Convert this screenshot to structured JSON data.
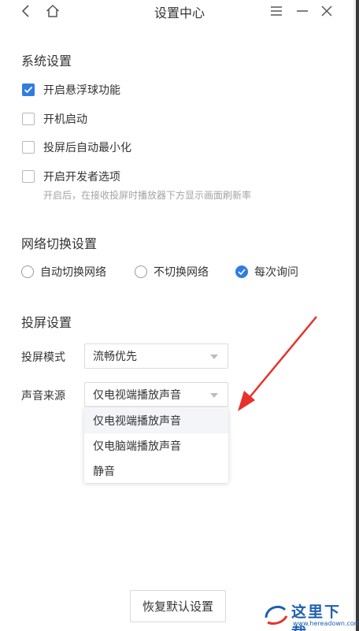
{
  "window": {
    "title": "设置中心"
  },
  "system_settings": {
    "heading": "系统设置",
    "options": [
      {
        "label": "开启悬浮球功能",
        "checked": true
      },
      {
        "label": "开机启动",
        "checked": false
      },
      {
        "label": "投屏后自动最小化",
        "checked": false
      },
      {
        "label": "开启开发者选项",
        "checked": false
      }
    ],
    "developer_hint": "开启后，在接收投屏时播放器下方显示画面刷新率"
  },
  "network_settings": {
    "heading": "网络切换设置",
    "options": [
      {
        "label": "自动切换网络",
        "selected": false
      },
      {
        "label": "不切换网络",
        "selected": false
      },
      {
        "label": "每次询问",
        "selected": true
      }
    ]
  },
  "cast_settings": {
    "heading": "投屏设置",
    "mode_label": "投屏模式",
    "mode_value": "流畅优先",
    "sound_label": "声音来源",
    "sound_value": "仅电视端播放声音",
    "sound_options": [
      "仅电视端播放声音",
      "仅电脑端播放声音",
      "静音"
    ]
  },
  "footer": {
    "reset_label": "恢复默认设置"
  },
  "watermark": {
    "text": "这里下载",
    "url": "www.hereadown.com"
  },
  "colors": {
    "accent": "#2f7de1",
    "annotation_arrow": "#e8312a"
  }
}
